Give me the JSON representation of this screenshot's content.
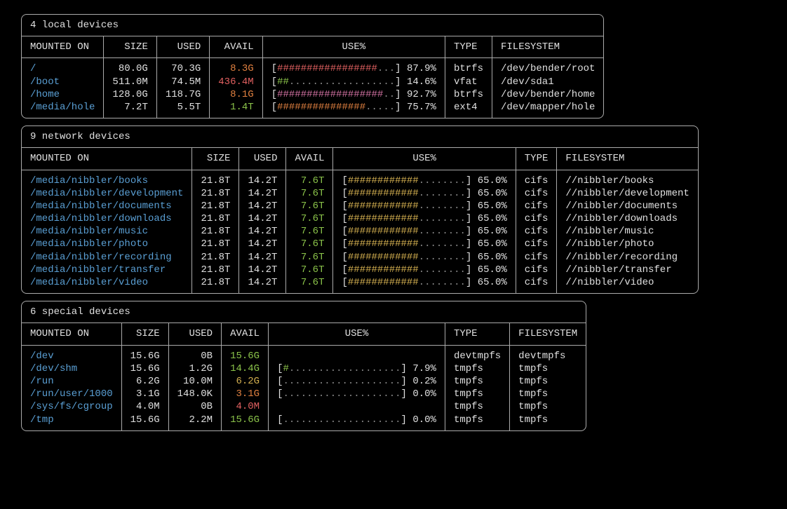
{
  "headers": {
    "mounted_on": "MOUNTED ON",
    "size": "SIZE",
    "used": "USED",
    "avail": "AVAIL",
    "use_pct": "USE%",
    "type": "TYPE",
    "filesystem": "FILESYSTEM"
  },
  "groups": [
    {
      "title": "4 local devices",
      "rows": [
        {
          "mount": "/",
          "size": "80.0G",
          "used": "70.3G",
          "avail": "8.3G",
          "avail_class": "avail-orange",
          "bar_hash": "#################",
          "bar_dots": "...",
          "bar_class": "bar-red",
          "pct": "87.9%",
          "type": "btrfs",
          "fs": "/dev/bender/root"
        },
        {
          "mount": "/boot",
          "size": "511.0M",
          "used": "74.5M",
          "avail": "436.4M",
          "avail_class": "avail-red",
          "bar_hash": "##",
          "bar_dots": "..................",
          "bar_class": "bar-green",
          "pct": "14.6%",
          "type": "vfat",
          "fs": "/dev/sda1"
        },
        {
          "mount": "/home",
          "size": "128.0G",
          "used": "118.7G",
          "avail": "8.1G",
          "avail_class": "avail-orange",
          "bar_hash": "##################",
          "bar_dots": "..",
          "bar_class": "bar-magenta",
          "pct": "92.7%",
          "type": "btrfs",
          "fs": "/dev/bender/home"
        },
        {
          "mount": "/media/hole",
          "size": "7.2T",
          "used": "5.5T",
          "avail": "1.4T",
          "avail_class": "avail-green",
          "bar_hash": "###############",
          "bar_dots": ".....",
          "bar_class": "bar-orange",
          "pct": "75.7%",
          "type": "ext4",
          "fs": "/dev/mapper/hole"
        }
      ]
    },
    {
      "title": "9 network devices",
      "rows": [
        {
          "mount": "/media/nibbler/books",
          "size": "21.8T",
          "used": "14.2T",
          "avail": "7.6T",
          "avail_class": "avail-green",
          "bar_hash": "############",
          "bar_dots": "........",
          "bar_class": "bar-yellow",
          "pct": "65.0%",
          "type": "cifs",
          "fs": "//nibbler/books"
        },
        {
          "mount": "/media/nibbler/development",
          "size": "21.8T",
          "used": "14.2T",
          "avail": "7.6T",
          "avail_class": "avail-green",
          "bar_hash": "############",
          "bar_dots": "........",
          "bar_class": "bar-yellow",
          "pct": "65.0%",
          "type": "cifs",
          "fs": "//nibbler/development"
        },
        {
          "mount": "/media/nibbler/documents",
          "size": "21.8T",
          "used": "14.2T",
          "avail": "7.6T",
          "avail_class": "avail-green",
          "bar_hash": "############",
          "bar_dots": "........",
          "bar_class": "bar-yellow",
          "pct": "65.0%",
          "type": "cifs",
          "fs": "//nibbler/documents"
        },
        {
          "mount": "/media/nibbler/downloads",
          "size": "21.8T",
          "used": "14.2T",
          "avail": "7.6T",
          "avail_class": "avail-green",
          "bar_hash": "############",
          "bar_dots": "........",
          "bar_class": "bar-yellow",
          "pct": "65.0%",
          "type": "cifs",
          "fs": "//nibbler/downloads"
        },
        {
          "mount": "/media/nibbler/music",
          "size": "21.8T",
          "used": "14.2T",
          "avail": "7.6T",
          "avail_class": "avail-green",
          "bar_hash": "############",
          "bar_dots": "........",
          "bar_class": "bar-yellow",
          "pct": "65.0%",
          "type": "cifs",
          "fs": "//nibbler/music"
        },
        {
          "mount": "/media/nibbler/photo",
          "size": "21.8T",
          "used": "14.2T",
          "avail": "7.6T",
          "avail_class": "avail-green",
          "bar_hash": "############",
          "bar_dots": "........",
          "bar_class": "bar-yellow",
          "pct": "65.0%",
          "type": "cifs",
          "fs": "//nibbler/photo"
        },
        {
          "mount": "/media/nibbler/recording",
          "size": "21.8T",
          "used": "14.2T",
          "avail": "7.6T",
          "avail_class": "avail-green",
          "bar_hash": "############",
          "bar_dots": "........",
          "bar_class": "bar-yellow",
          "pct": "65.0%",
          "type": "cifs",
          "fs": "//nibbler/recording"
        },
        {
          "mount": "/media/nibbler/transfer",
          "size": "21.8T",
          "used": "14.2T",
          "avail": "7.6T",
          "avail_class": "avail-green",
          "bar_hash": "############",
          "bar_dots": "........",
          "bar_class": "bar-yellow",
          "pct": "65.0%",
          "type": "cifs",
          "fs": "//nibbler/transfer"
        },
        {
          "mount": "/media/nibbler/video",
          "size": "21.8T",
          "used": "14.2T",
          "avail": "7.6T",
          "avail_class": "avail-green",
          "bar_hash": "############",
          "bar_dots": "........",
          "bar_class": "bar-yellow",
          "pct": "65.0%",
          "type": "cifs",
          "fs": "//nibbler/video"
        }
      ]
    },
    {
      "title": "6 special devices",
      "rows": [
        {
          "mount": "/dev",
          "size": "15.6G",
          "used": "0B",
          "avail": "15.6G",
          "avail_class": "avail-green",
          "bar_hash": "",
          "bar_dots": "",
          "bar_class": "bar-green",
          "pct": "",
          "type": "devtmpfs",
          "fs": "devtmpfs"
        },
        {
          "mount": "/dev/shm",
          "size": "15.6G",
          "used": "1.2G",
          "avail": "14.4G",
          "avail_class": "avail-green",
          "bar_hash": "#",
          "bar_dots": "...................",
          "bar_class": "bar-green",
          "pct": "7.9%",
          "type": "tmpfs",
          "fs": "tmpfs"
        },
        {
          "mount": "/run",
          "size": "6.2G",
          "used": "10.0M",
          "avail": "6.2G",
          "avail_class": "avail-yellow",
          "bar_hash": "",
          "bar_dots": "....................",
          "bar_class": "bar-green",
          "pct": "0.2%",
          "type": "tmpfs",
          "fs": "tmpfs"
        },
        {
          "mount": "/run/user/1000",
          "size": "3.1G",
          "used": "148.0K",
          "avail": "3.1G",
          "avail_class": "avail-orange",
          "bar_hash": "",
          "bar_dots": "....................",
          "bar_class": "bar-green",
          "pct": "0.0%",
          "type": "tmpfs",
          "fs": "tmpfs"
        },
        {
          "mount": "/sys/fs/cgroup",
          "size": "4.0M",
          "used": "0B",
          "avail": "4.0M",
          "avail_class": "avail-red",
          "bar_hash": "",
          "bar_dots": "",
          "bar_class": "bar-green",
          "pct": "",
          "type": "tmpfs",
          "fs": "tmpfs"
        },
        {
          "mount": "/tmp",
          "size": "15.6G",
          "used": "2.2M",
          "avail": "15.6G",
          "avail_class": "avail-green",
          "bar_hash": "",
          "bar_dots": "....................",
          "bar_class": "bar-green",
          "pct": "0.0%",
          "type": "tmpfs",
          "fs": "tmpfs"
        }
      ]
    }
  ]
}
